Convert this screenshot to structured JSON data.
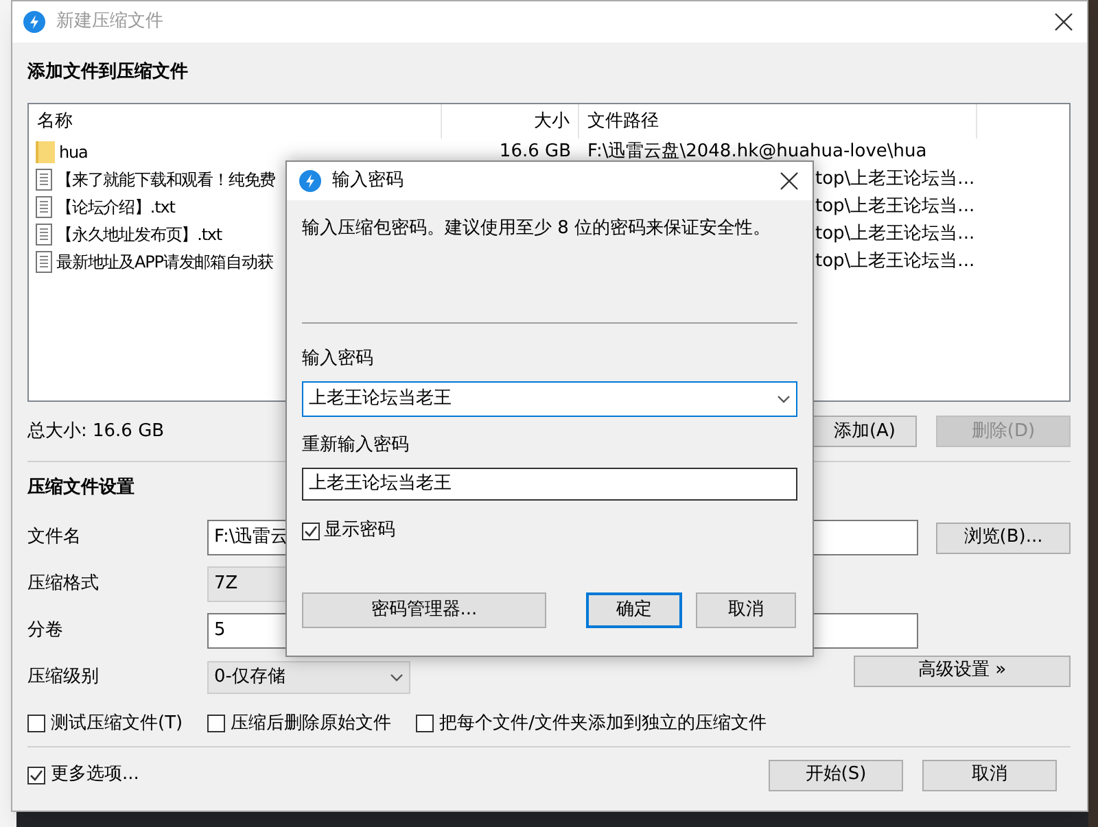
{
  "window": {
    "title": "新建压缩文件"
  },
  "add_section": {
    "heading": "添加文件到压缩文件"
  },
  "file_list": {
    "columns": [
      "名称",
      "大小",
      "文件路径"
    ],
    "rows": [
      {
        "kind": "folder",
        "name": "hua",
        "size": "16.6 GB",
        "path": "F:\\迅雷云盘\\2048.hk@huahua-love\\hua"
      },
      {
        "kind": "file",
        "name": "【来了就能下载和观看！纯免费",
        "path": "top\\上老王论坛当..."
      },
      {
        "kind": "file",
        "name": "【论坛介绍】.txt",
        "path": "top\\上老王论坛当..."
      },
      {
        "kind": "file",
        "name": "【永久地址发布页】.txt",
        "path": "top\\上老王论坛当..."
      },
      {
        "kind": "file",
        "name": "最新地址及APP请发邮箱自动获",
        "path": "top\\上老王论坛当..."
      }
    ]
  },
  "total_size": "总大小: 16.6 GB",
  "list_buttons": [
    {
      "label": "添加(A)",
      "disabled": false
    },
    {
      "label": "删除(D)",
      "disabled": true
    }
  ],
  "settings": {
    "heading": "压缩文件设置",
    "fields": [
      {
        "kind": "text",
        "label": "文件名",
        "value": "F:\\迅雷云"
      },
      {
        "kind": "readonly",
        "label": "压缩格式",
        "value": "7Z"
      },
      {
        "kind": "text",
        "label": "分卷",
        "value": "5"
      },
      {
        "kind": "select",
        "label": "压缩级别",
        "value": "0-仅存储"
      }
    ],
    "browse_button": "浏览(B)...",
    "advanced_button": "高级设置 »",
    "options": [
      {
        "label": "测试压缩文件(T)",
        "checked": false
      },
      {
        "label": "压缩后删除原始文件",
        "checked": false
      },
      {
        "label": "把每个文件/文件夹添加到独立的压缩文件",
        "checked": false
      }
    ]
  },
  "more_options": {
    "label": "更多选项...",
    "checked": true
  },
  "footer_buttons": [
    "开始(S)",
    "取消"
  ],
  "dialog": {
    "title": "输入密码",
    "message": "输入压缩包密码。建议使用至少 8 位的密码来保证安全性。",
    "password_label": "输入密码",
    "password_value": "上老王论坛当老王",
    "confirm_label": "重新输入密码",
    "confirm_value": "上老王论坛当老王",
    "show_password": {
      "label": "显示密码",
      "checked": true
    },
    "buttons": [
      {
        "label": "密码管理器...",
        "default": false
      },
      {
        "label": "确定",
        "default": true
      },
      {
        "label": "取消",
        "default": false
      }
    ]
  }
}
